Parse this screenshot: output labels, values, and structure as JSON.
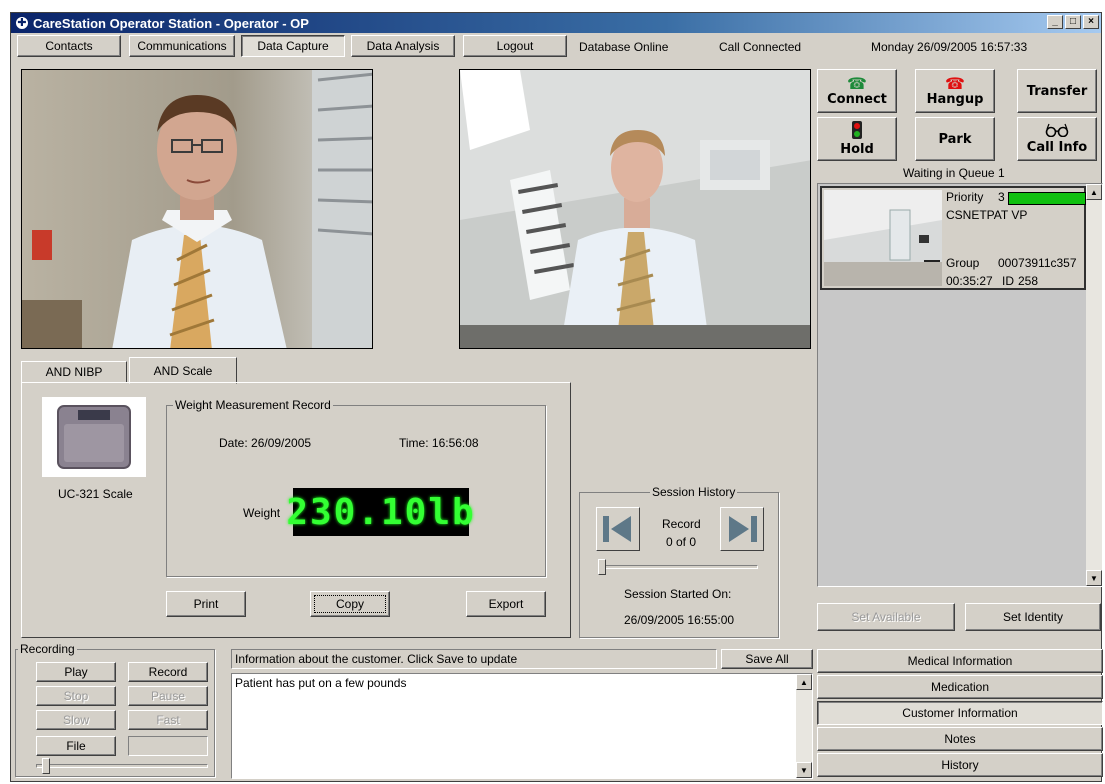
{
  "window": {
    "title": "CareStation Operator Station - Operator - OP"
  },
  "nav": {
    "contacts": "Contacts",
    "communications": "Communications",
    "data_capture": "Data Capture",
    "data_analysis": "Data Analysis",
    "logout": "Logout"
  },
  "status": {
    "database": "Database Online",
    "call": "Call Connected",
    "datetime": "Monday  26/09/2005  16:57:33"
  },
  "call_controls": {
    "connect": "Connect",
    "hangup": "Hangup",
    "transfer": "Transfer",
    "hold": "Hold",
    "park": "Park",
    "call_info": "Call Info",
    "connect_color": "#1e8a3a",
    "hangup_color": "#e01010"
  },
  "queue": {
    "title": "Waiting in Queue 1",
    "item": {
      "priority_label": "Priority",
      "priority_value": "3",
      "priority_level": 1.0,
      "priority_color": "#10c010",
      "name": "CSNETPAT VP",
      "group_label": "Group",
      "group_value": "00073911c357",
      "elapsed": "00:35:27",
      "id_label": "ID",
      "id_value": "258"
    },
    "set_available": "Set Available",
    "set_identity": "Set Identity"
  },
  "tabs": {
    "nibp": "AND NIBP",
    "scale": "AND Scale"
  },
  "device": {
    "name": "UC-321 Scale"
  },
  "weight_record": {
    "title": "Weight Measurement Record",
    "date": "Date: 26/09/2005",
    "time": "Time: 16:56:08",
    "weight_label": "Weight",
    "weight_value": "230.10lb",
    "print": "Print",
    "copy": "Copy",
    "export": "Export"
  },
  "session_history": {
    "title": "Session History",
    "record_label": "Record",
    "record_count": "0 of 0",
    "started_label": "Session Started On:",
    "started_value": "26/09/2005 16:55:00"
  },
  "recording": {
    "title": "Recording",
    "play": "Play",
    "record": "Record",
    "stop": "Stop",
    "pause": "Pause",
    "slow": "Slow",
    "fast": "Fast",
    "file": "File"
  },
  "customer_info": {
    "prompt": "Information about the customer. Click Save to update",
    "save_all": "Save All",
    "notes_text": "Patient has put on a few pounds"
  },
  "side_menu": {
    "medical": "Medical Information",
    "medication": "Medication",
    "customer": "Customer Information",
    "notes": "Notes",
    "history": "History"
  }
}
